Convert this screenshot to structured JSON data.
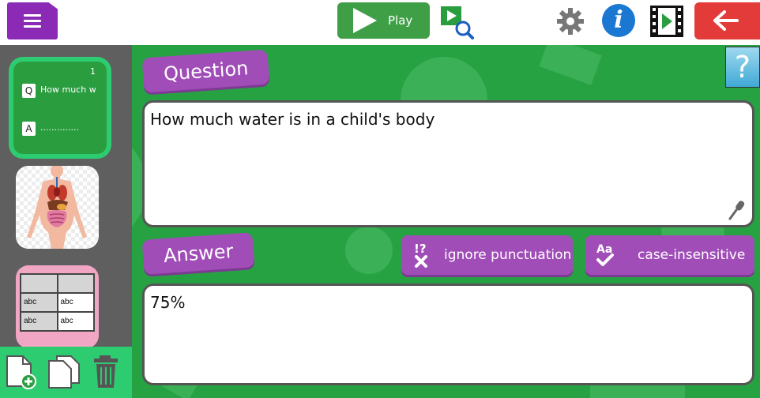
{
  "toolbar": {
    "play_label": "Play",
    "colors": {
      "play": "#3f9f47",
      "back": "#e33a3a",
      "menu": "#8a2ab5",
      "info": "#1a78d2"
    },
    "icons": [
      "menu-icon",
      "play-icon",
      "preview-search-icon",
      "gear-icon",
      "info-icon",
      "film-play-icon",
      "back-arrow-icon"
    ]
  },
  "sidebar": {
    "slides": [
      {
        "number": "1",
        "q_marker": "Q",
        "q_text": "How much w",
        "a_marker": "A",
        "a_text": "..............",
        "selected": true
      },
      {
        "kind": "image",
        "icon": "human-anatomy-image"
      },
      {
        "kind": "table",
        "cells": [
          "",
          "",
          "abc",
          "abc",
          "abc",
          "abc"
        ]
      }
    ],
    "actions": [
      "add-slide-icon",
      "duplicate-slide-icon",
      "trash-icon"
    ]
  },
  "editor": {
    "question_label": "Question",
    "question_text": "How much water is in a child's body",
    "answer_label": "Answer",
    "answer_text": "75%",
    "options": {
      "ignore_punctuation": "ignore punctuation",
      "case_insensitive": "case-insensitive",
      "case_icon_text": "Aa",
      "punct_icon_text": "!?"
    },
    "help_label": "?",
    "colors": {
      "background": "#27a243",
      "accent": "#a14db8",
      "highlight": "#2ecc71"
    }
  }
}
